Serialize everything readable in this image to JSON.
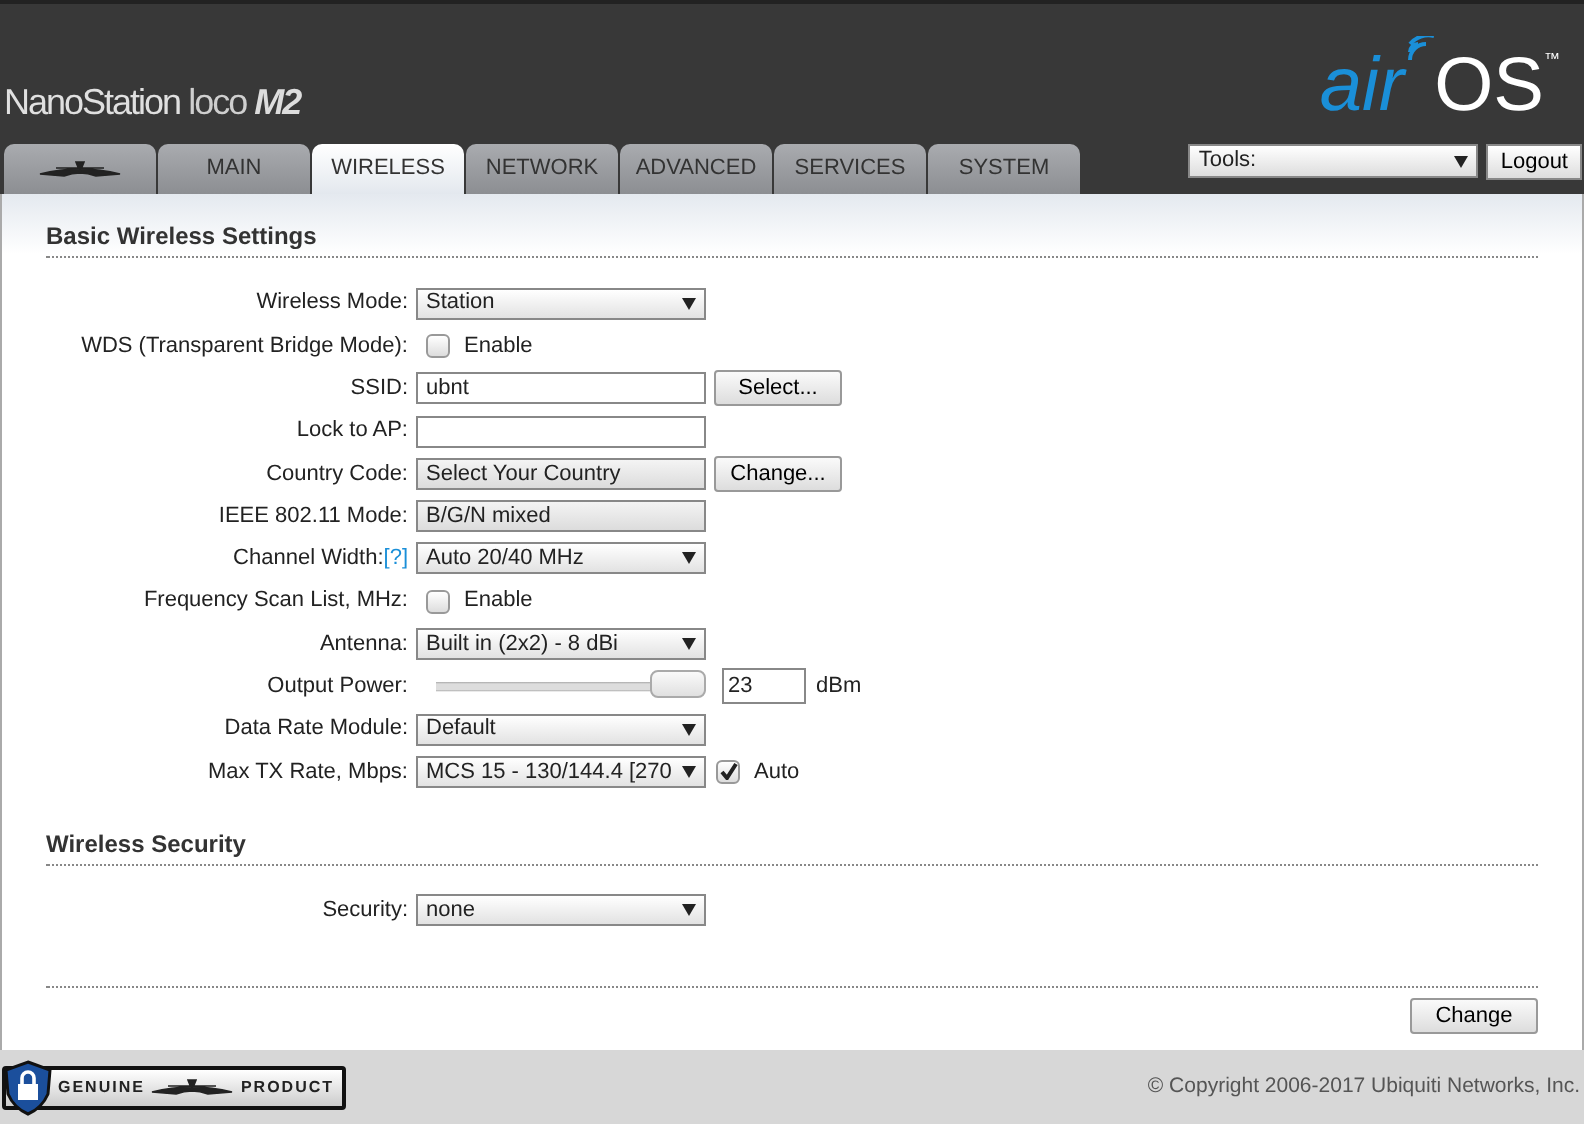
{
  "header": {
    "product": "NanoStation",
    "model_line": "loco",
    "model": "M2",
    "logo_air": "air",
    "logo_os": "OS",
    "logo_tm": "™"
  },
  "tabs": [
    {
      "kind": "logo",
      "selected": false
    },
    {
      "kind": "text",
      "label": "MAIN",
      "selected": false
    },
    {
      "kind": "text",
      "label": "WIRELESS",
      "selected": true
    },
    {
      "kind": "text",
      "label": "NETWORK",
      "selected": false
    },
    {
      "kind": "text",
      "label": "ADVANCED",
      "selected": false
    },
    {
      "kind": "text",
      "label": "SERVICES",
      "selected": false
    },
    {
      "kind": "text",
      "label": "SYSTEM",
      "selected": false
    }
  ],
  "tools": {
    "value": "Tools:",
    "logout": "Logout"
  },
  "sections": [
    {
      "title": "Basic Wireless Settings",
      "rows": [
        {
          "kind": "select",
          "label": "Wireless Mode:",
          "value": "Station"
        },
        {
          "kind": "checkbox",
          "label": "WDS (Transparent Bridge Mode):",
          "checked": false,
          "option": "Enable"
        },
        {
          "kind": "text",
          "label": "SSID:",
          "value": "ubnt",
          "button": "Select..."
        },
        {
          "kind": "text",
          "label": "Lock to AP:"
        },
        {
          "kind": "readonly",
          "label": "Country Code:",
          "value": "Select Your Country",
          "button": "Change..."
        },
        {
          "kind": "readonly",
          "label": "IEEE 802.11 Mode:",
          "value": "B/G/N mixed"
        },
        {
          "kind": "select",
          "label": "Channel Width:",
          "help": "[?]",
          "value": "Auto 20/40 MHz"
        },
        {
          "kind": "checkbox",
          "label": "Frequency Scan List, MHz:",
          "checked": false,
          "option": "Enable"
        },
        {
          "kind": "select",
          "label": "Antenna:",
          "value": "Built in (2x2) - 8 dBi"
        },
        {
          "kind": "slider",
          "label": "Output Power:",
          "level": 1,
          "value": "23",
          "unit": "dBm"
        },
        {
          "kind": "select",
          "label": "Data Rate Module:",
          "value": "Default"
        },
        {
          "kind": "select",
          "label": "Max TX Rate, Mbps:",
          "value": "MCS 15 - 130/144.4 [270",
          "checked": true,
          "option": "Auto"
        }
      ]
    },
    {
      "title": "Wireless Security",
      "rows": [
        {
          "kind": "select",
          "label": "Security:",
          "value": "none"
        }
      ]
    }
  ],
  "change_button": "Change",
  "footer": {
    "badge_left": "GENUINE",
    "badge_right": "PRODUCT",
    "copyright": "© Copyright 2006-2017 Ubiquiti Networks, Inc."
  }
}
